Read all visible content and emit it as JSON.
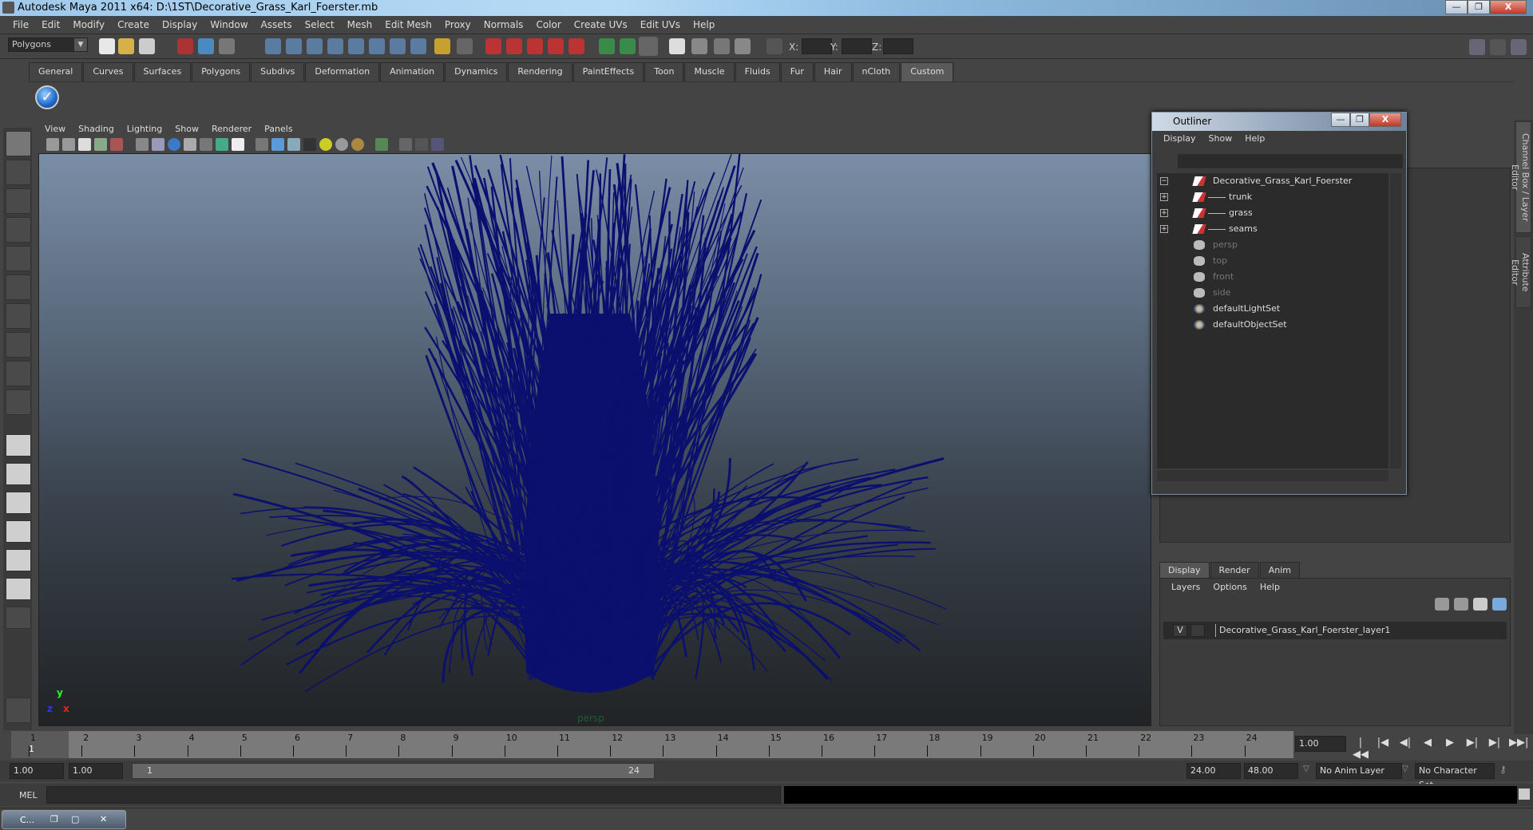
{
  "window": {
    "title": "Autodesk Maya 2011 x64: D:\\1ST\\Decorative_Grass_Karl_Foerster.mb",
    "minimize": "—",
    "restore": "❐",
    "close": "X"
  },
  "menubar": [
    "File",
    "Edit",
    "Modify",
    "Create",
    "Display",
    "Window",
    "Assets",
    "Select",
    "Mesh",
    "Edit Mesh",
    "Proxy",
    "Normals",
    "Color",
    "Create UVs",
    "Edit UVs",
    "Help"
  ],
  "statusline": {
    "mode": "Polygons",
    "x_label": "X:",
    "y_label": "Y:",
    "z_label": "Z:",
    "x_value": "",
    "y_value": "",
    "z_value": ""
  },
  "shelf": {
    "tabs": [
      "General",
      "Curves",
      "Surfaces",
      "Polygons",
      "Subdivs",
      "Deformation",
      "Animation",
      "Dynamics",
      "Rendering",
      "PaintEffects",
      "Toon",
      "Muscle",
      "Fluids",
      "Fur",
      "Hair",
      "nCloth",
      "Custom"
    ],
    "active_tab": "Custom",
    "item_glyph": "✓"
  },
  "viewport": {
    "menu": [
      "View",
      "Shading",
      "Lighting",
      "Show",
      "Renderer",
      "Panels"
    ],
    "camera_label": "persp",
    "axis": {
      "x": "x",
      "y": "y",
      "z": "z"
    },
    "mesh_color": "#0b0f6e"
  },
  "outliner": {
    "title": "Outliner",
    "menu": [
      "Display",
      "Show",
      "Help"
    ],
    "filter_value": "",
    "items": [
      {
        "label": "Decorative_Grass_Karl_Foerster",
        "type": "transform",
        "expand": "−",
        "dim": false,
        "indent": 0
      },
      {
        "label": "trunk",
        "type": "transform",
        "expand": "+",
        "dim": false,
        "indent": 1
      },
      {
        "label": "grass",
        "type": "transform",
        "expand": "+",
        "dim": false,
        "indent": 1
      },
      {
        "label": "seams",
        "type": "transform",
        "expand": "+",
        "dim": false,
        "indent": 1
      },
      {
        "label": "persp",
        "type": "camera",
        "expand": "",
        "dim": true,
        "indent": 0
      },
      {
        "label": "top",
        "type": "camera",
        "expand": "",
        "dim": true,
        "indent": 0
      },
      {
        "label": "front",
        "type": "camera",
        "expand": "",
        "dim": true,
        "indent": 0
      },
      {
        "label": "side",
        "type": "camera",
        "expand": "",
        "dim": true,
        "indent": 0
      },
      {
        "label": "defaultLightSet",
        "type": "set",
        "expand": "",
        "dim": false,
        "indent": 0
      },
      {
        "label": "defaultObjectSet",
        "type": "set",
        "expand": "",
        "dim": false,
        "indent": 0
      }
    ]
  },
  "side_tabs": [
    "Channel Box / Layer Editor",
    "Attribute Editor"
  ],
  "layer_editor": {
    "tabs": [
      "Display",
      "Render",
      "Anim"
    ],
    "active_tab": "Display",
    "menu": [
      "Layers",
      "Options",
      "Help"
    ],
    "layers": [
      {
        "visible": "V",
        "name": "Decorative_Grass_Karl_Foerster_layer1"
      }
    ]
  },
  "timeline": {
    "ticks": [
      "1",
      "2",
      "3",
      "4",
      "5",
      "6",
      "7",
      "8",
      "9",
      "10",
      "11",
      "12",
      "13",
      "14",
      "15",
      "16",
      "17",
      "18",
      "19",
      "20",
      "21",
      "22",
      "23",
      "24"
    ],
    "current_frame_marker": "1",
    "current_time": "1.00",
    "playback": [
      "|◀◀",
      "|◀",
      "◀|",
      "◀",
      "▶",
      "▶|",
      "▶|",
      "▶▶|"
    ]
  },
  "range": {
    "start_time": "1.00",
    "playback_start": "1.00",
    "slider_start": "1",
    "slider_end": "24",
    "playback_end": "24.00",
    "end_time": "48.00",
    "anim_layer": "No Anim Layer",
    "character_set": "No Character Set"
  },
  "command_line": {
    "label": "MEL",
    "value": "",
    "result": ""
  },
  "taskbar": {
    "minimized_window": "C..."
  }
}
